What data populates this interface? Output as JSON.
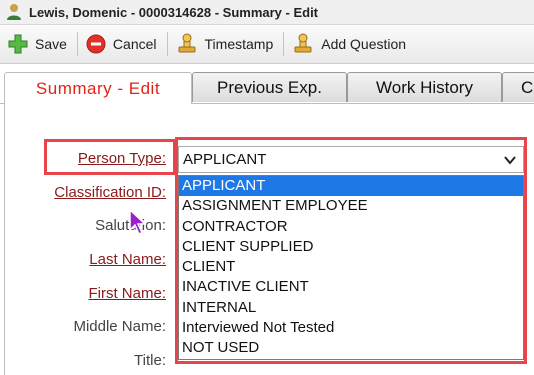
{
  "window": {
    "title": "Lewis, Domenic - 0000314628 - Summary - Edit",
    "user_icon": "person-icon"
  },
  "toolbar": {
    "save_label": "Save",
    "cancel_label": "Cancel",
    "timestamp_label": "Timestamp",
    "add_question_label": "Add Question"
  },
  "tabs": [
    {
      "label": "Summary - Edit",
      "active": true
    },
    {
      "label": "Previous Exp.",
      "active": false
    },
    {
      "label": "Work History",
      "active": false
    },
    {
      "label": "C",
      "active": false
    }
  ],
  "form": {
    "person_type_label": "Person Type:",
    "classification_label": "Classification ID:",
    "salutation_label": "Salutation:",
    "last_name_label": "Last Name:",
    "first_name_label": "First Name:",
    "middle_name_label": "Middle Name:",
    "title_label": "Title:"
  },
  "person_type_select": {
    "value": "APPLICANT",
    "options": [
      "APPLICANT",
      "ASSIGNMENT EMPLOYEE",
      "CONTRACTOR",
      "CLIENT SUPPLIED",
      "CLIENT",
      "INACTIVE CLIENT",
      "INTERNAL",
      "Interviewed Not Tested",
      "NOT USED"
    ],
    "highlighted": "APPLICANT"
  },
  "colors": {
    "accent": "#e0241a",
    "highlight": "#1e78e6",
    "annotation": "#e8454a",
    "required_label": "#8b1a1a"
  }
}
